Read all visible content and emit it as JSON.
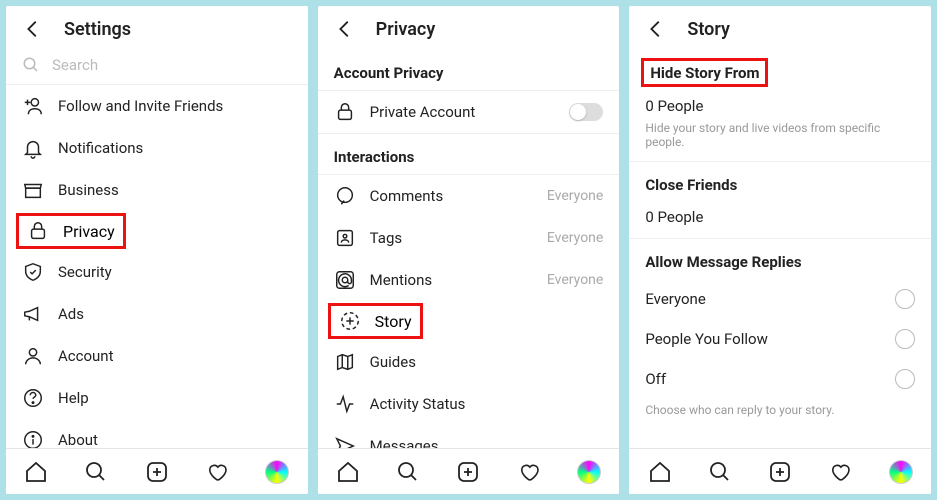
{
  "screens": {
    "settings": {
      "title": "Settings",
      "search_placeholder": "Search",
      "items": [
        {
          "icon": "add-user",
          "label": "Follow and Invite Friends"
        },
        {
          "icon": "bell",
          "label": "Notifications"
        },
        {
          "icon": "shop",
          "label": "Business"
        },
        {
          "icon": "lock",
          "label": "Privacy",
          "highlight": true
        },
        {
          "icon": "shield",
          "label": "Security"
        },
        {
          "icon": "megaphone",
          "label": "Ads"
        },
        {
          "icon": "user",
          "label": "Account"
        },
        {
          "icon": "help",
          "label": "Help"
        },
        {
          "icon": "info",
          "label": "About"
        }
      ]
    },
    "privacy": {
      "title": "Privacy",
      "sections": {
        "account_privacy": {
          "header": "Account Privacy",
          "item": {
            "icon": "lock",
            "label": "Private Account",
            "toggle": false
          }
        },
        "interactions": {
          "header": "Interactions",
          "items": [
            {
              "icon": "comment",
              "label": "Comments",
              "trail": "Everyone"
            },
            {
              "icon": "tag",
              "label": "Tags",
              "trail": "Everyone"
            },
            {
              "icon": "mention",
              "label": "Mentions",
              "trail": "Everyone"
            },
            {
              "icon": "story",
              "label": "Story",
              "highlight": true
            },
            {
              "icon": "guides",
              "label": "Guides"
            },
            {
              "icon": "activity",
              "label": "Activity Status"
            },
            {
              "icon": "messages",
              "label": "Messages"
            }
          ]
        }
      }
    },
    "story": {
      "title": "Story",
      "hide_from": {
        "header": "Hide Story From",
        "value": "0 People",
        "hint": "Hide your story and live videos from specific people."
      },
      "close_friends": {
        "header": "Close Friends",
        "value": "0 People"
      },
      "replies": {
        "header": "Allow Message Replies",
        "options": [
          "Everyone",
          "People You Follow",
          "Off"
        ],
        "hint": "Choose who can reply to your story."
      }
    }
  }
}
